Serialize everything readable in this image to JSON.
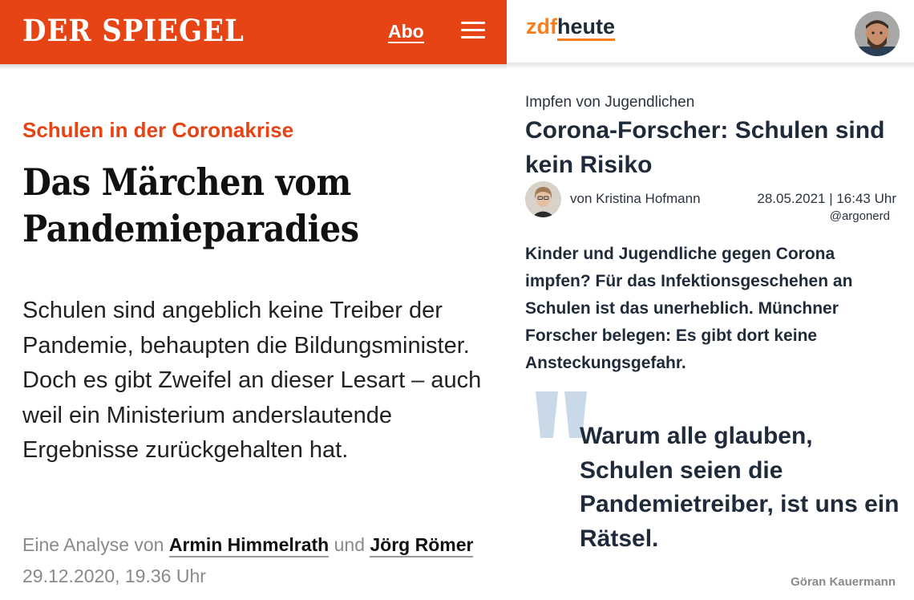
{
  "spiegel": {
    "brand_color": "#e64415",
    "logo": "DER SPIEGEL",
    "abo_label": "Abo",
    "menu_icon": "hamburger-menu-icon",
    "kicker": "Schulen in der Coronakrise",
    "title": "Das Märchen vom Pandemieparadies",
    "lead": "Schulen sind angeblich keine Treiber der Pandemie, behaupten die Bildungsminister. Doch es gibt Zweifel an dieser Lesart – auch weil ein Ministerium anderslautende Ergebnisse zurückgehalten hat.",
    "byline": {
      "prefix": "Eine Analyse von",
      "author1": "Armin Himmelrath",
      "conjunction": "und",
      "author2": "Jörg Römer"
    },
    "date": "29.12.2020, 19.36 Uhr"
  },
  "zdf": {
    "accent_color": "#fa7d19",
    "logo_part1": "zdf",
    "logo_part2": "heute",
    "avatar": "profile-avatar",
    "kicker": "Impfen von Jugendlichen",
    "title": "Corona-Forscher: Schulen sind kein Risiko",
    "author": "von Kristina Hofmann",
    "datetime": "28.05.2021 | 16:43 Uhr",
    "handle": "@argonerd",
    "lead": "Kinder und Jugendliche gegen Corona impfen? Für das Infektionsgeschehen an Schulen ist das unerheblich. Münchner Forscher belegen: Es gibt dort keine Ansteckungsgefahr.",
    "quote": "Warum alle glauben, Schulen seien die Pandemietreiber, ist uns ein Rätsel.",
    "quote_author": "Göran Kauermann"
  }
}
